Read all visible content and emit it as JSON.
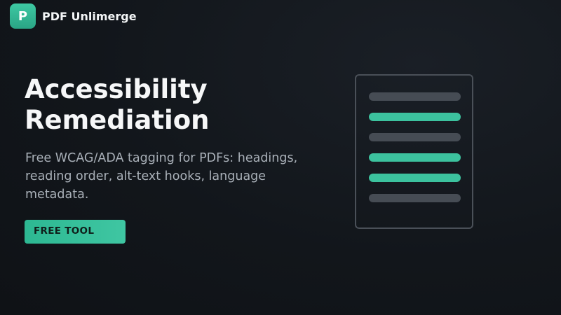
{
  "header": {
    "logo_letter": "P",
    "brand_name": "PDF Unlimerge"
  },
  "hero": {
    "title_line1": "Accessibility",
    "title_line2": "Remediation",
    "description": "Free WCAG/ADA tagging for PDFs: headings, reading order, alt-text hooks, language metadata.",
    "cta_label": "FREE TOOL"
  },
  "illustration": {
    "icon": "document-icon",
    "lines": [
      "muted",
      "accent",
      "muted",
      "accent",
      "accent",
      "muted"
    ]
  },
  "colors": {
    "background": "#12161b",
    "accent": "#3cc29e",
    "muted_line": "#464c54",
    "text_primary": "#f6f7f8",
    "text_secondary": "#a9b0b8"
  }
}
